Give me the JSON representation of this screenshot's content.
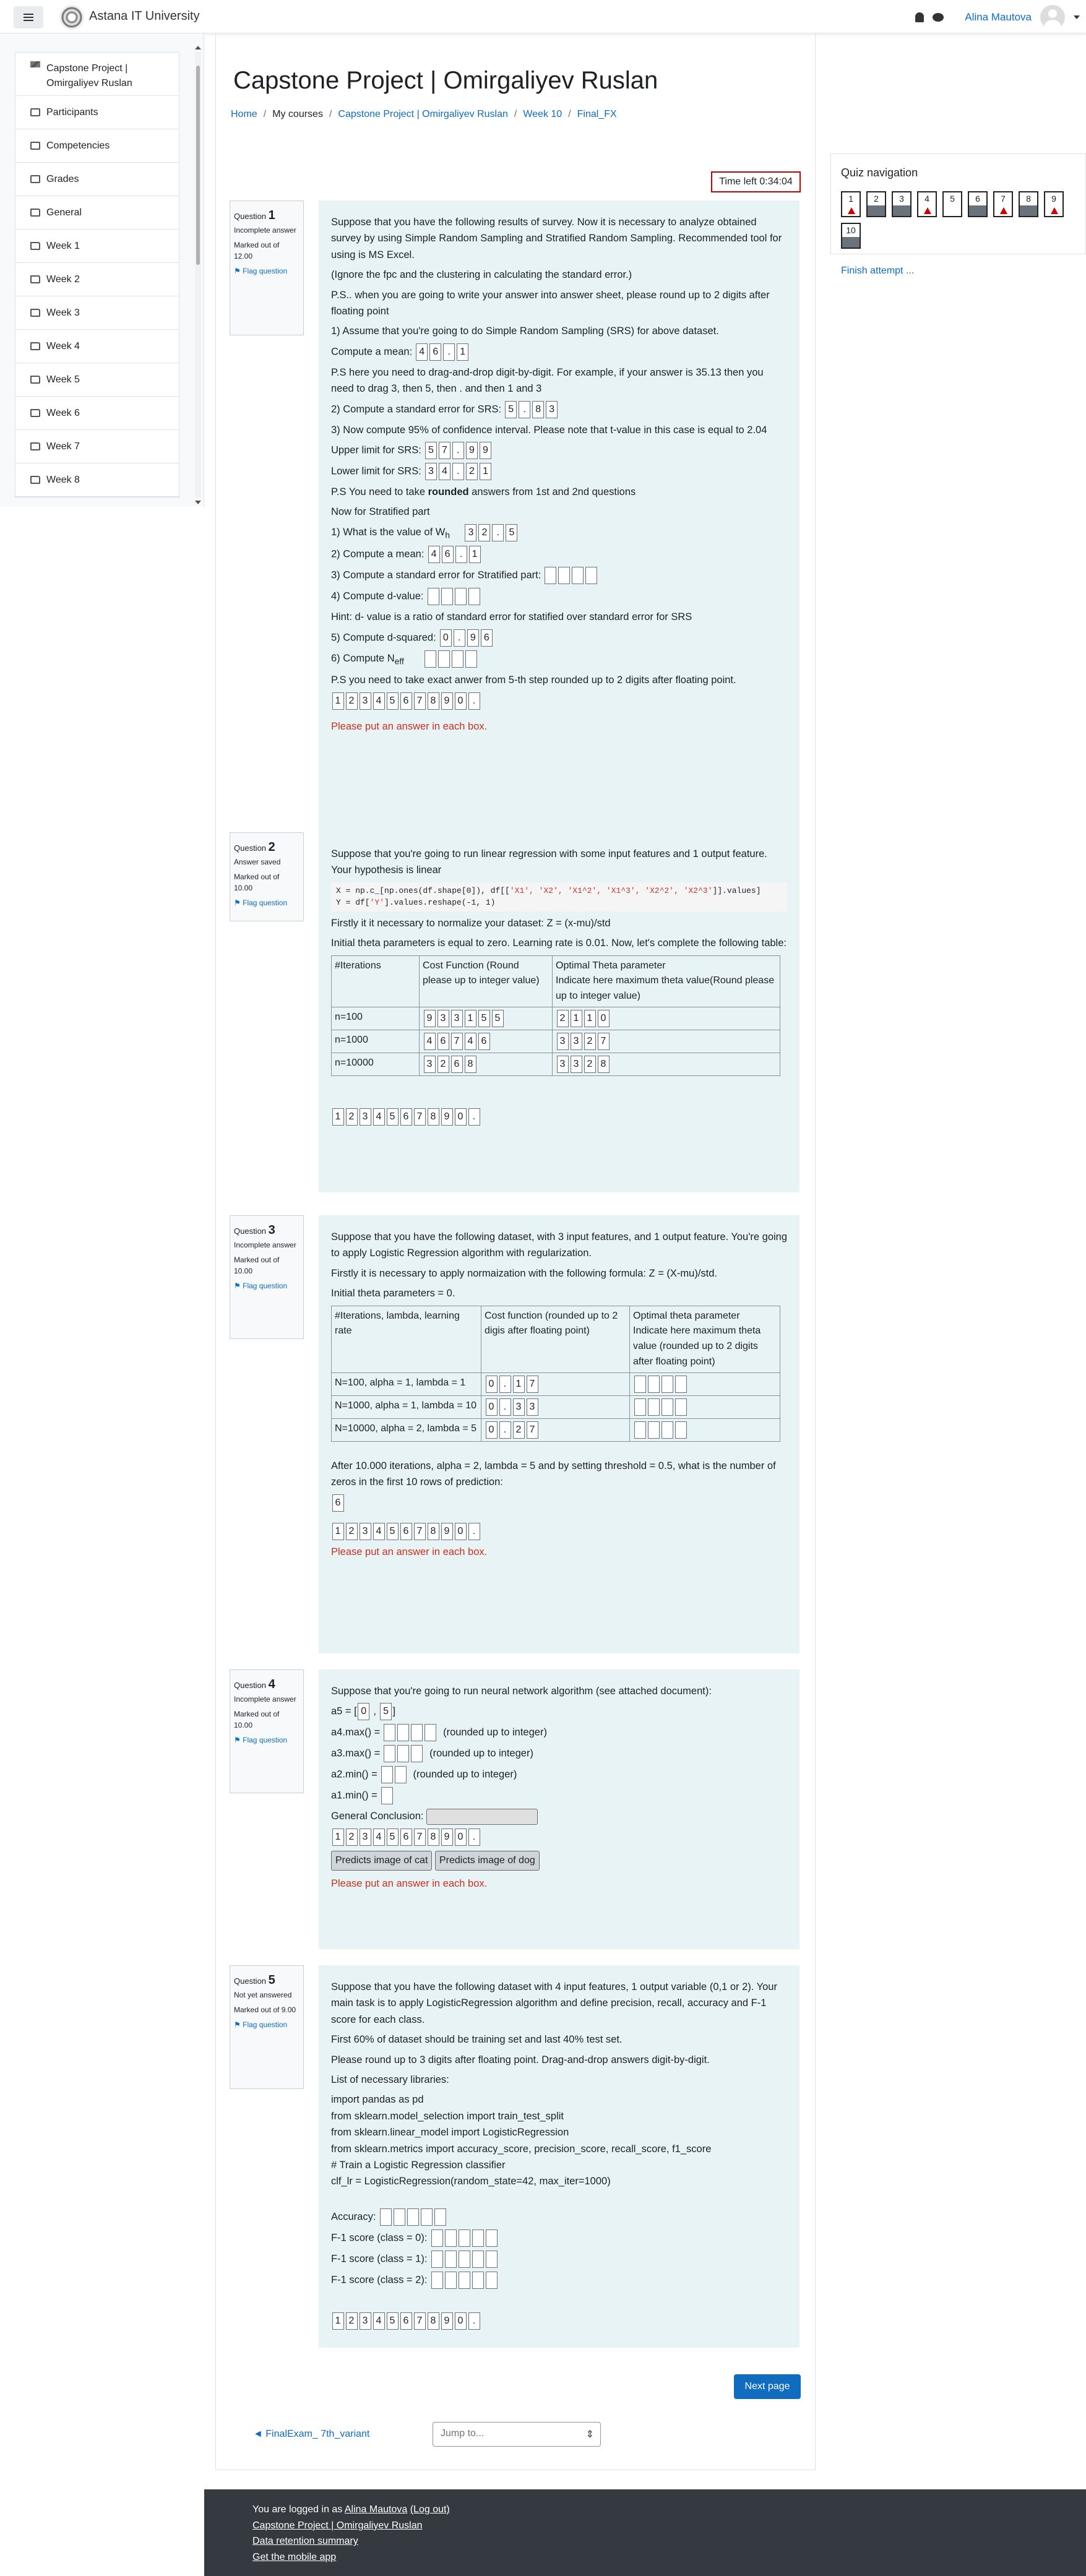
{
  "site": {
    "name": "Astana IT University"
  },
  "user": {
    "name": "Alina Mautova"
  },
  "drawer": {
    "items": [
      {
        "label": "Capstone Project | Omirgaliyev Ruslan",
        "icon": "graduation-cap-icon"
      },
      {
        "label": "Participants",
        "icon": "users-icon"
      },
      {
        "label": "Competencies",
        "icon": "checkbox-icon"
      },
      {
        "label": "Grades",
        "icon": "table-icon"
      },
      {
        "label": "General",
        "icon": "folder-icon"
      },
      {
        "label": "Week 1",
        "icon": "folder-icon"
      },
      {
        "label": "Week 2",
        "icon": "folder-icon"
      },
      {
        "label": "Week 3",
        "icon": "folder-icon"
      },
      {
        "label": "Week 4",
        "icon": "folder-icon"
      },
      {
        "label": "Week 5",
        "icon": "folder-icon"
      },
      {
        "label": "Week 6",
        "icon": "folder-icon"
      },
      {
        "label": "Week 7",
        "icon": "folder-icon"
      },
      {
        "label": "Week 8",
        "icon": "folder-icon"
      }
    ]
  },
  "page": {
    "title": "Capstone Project | Omirgaliyev Ruslan"
  },
  "breadcrumb": [
    "Home",
    "My courses",
    "Capstone Project | Omirgaliyev Ruslan",
    "Week 10",
    "Final_FX"
  ],
  "timer": "Time left 0:34:04",
  "flag_label": "Flag question",
  "q1": {
    "no": "1",
    "state": "Incomplete answer",
    "marks": "Marked out of 12.00",
    "text1": "Suppose that you have the following results of survey. Now it is necessary to analyze obtained survey by using Simple Random Sampling and Stratified Random Sampling. Recommended tool for using is MS Excel.",
    "text2": "(Ignore the fpc and the clustering in calculating the standard error.)",
    "text3": "P.S.. when you are going to write your answer into answer sheet, please round up to 2 digits after floating point",
    "text4": "1) Assume that you're going to do Simple Random Sampling (SRS) for above dataset.",
    "l_mean": "Compute a mean:",
    "text5": "P.S here you need to drag-and-drop digit-by-digit. For example, if your answer is 35.13 then you need to drag 3, then 5, then . and then 1 and 3",
    "l_se": "2) Compute a standard error for SRS:",
    "text6": "3) Now compute 95% of confidence interval. Please note that t-value in this case is equal to 2.04",
    "l_upper": "Upper limit for SRS:",
    "l_lower": "Lower limit for SRS:",
    "text7a": "P.S You need to take ",
    "text7b": "rounded",
    "text7c": " answers from 1st and 2nd questions",
    "text8": "Now for Stratified part",
    "l_wh": "1) What is the value of W",
    "l_wh_sub": "h",
    "l_mean2": "2) Compute a mean:",
    "l_se2": "3) Compute a standard error for Stratified part:",
    "l_d": "4) Compute d-value:",
    "text9": "Hint: d- value is a ratio of standard error for statified over standard error for SRS",
    "l_d2": "5) Compute d-squared:",
    "l_neff": "6) Compute N",
    "l_neff_sub": "eff",
    "text10": "P.S you need to take exact anwer from 5-th step rounded up to 2 digits after floating point.",
    "error": "Please put an answer in each box."
  },
  "q2": {
    "no": "2",
    "state": "Answer saved",
    "marks": "Marked out of 10.00",
    "text1": "Suppose that you're going to run linear regression with some input features and 1 output feature. Your hypothesis is linear",
    "code1a": "X = np.c_[np.ones(df.shape[0]), df[[",
    "code1s": "'X1', 'X2', 'X1^2', 'X1^3', 'X2^2', 'X2^3'",
    "code1b": "]].values]",
    "code2a": "Y = df[",
    "code2s": "'Y'",
    "code2b": "].values.reshape(-1, 1)",
    "text2": "Firstly it it necessary to normalize your dataset: Z = (x-mu)/std",
    "text3": "Initial theta parameters is equal to zero. Learning rate is 0.01. Now, let's complete the following table:",
    "th1": "#Iterations",
    "th2": "Cost Function (Round please up to integer value)",
    "th3": "Optimal Theta parameter",
    "th3b": "Indicate here maximum theta value(Round please up to integer value)",
    "r1": "n=100",
    "r2": "n=1000",
    "r3": "n=10000"
  },
  "q3": {
    "no": "3",
    "state": "Incomplete answer",
    "marks": "Marked out of 10.00",
    "text1": "Suppose that you have the following dataset, with 3 input features, and 1 output feature. You're going to apply Logistic Regression algorithm with regularization.",
    "text2": "Firstly it is necessary to apply normaization with the following formula: Z = (X-mu)/std.",
    "text3": "Initial theta parameters = 0.",
    "th1": "#Iterations, lambda, learning rate",
    "th2": "Cost function (rounded up to 2 digis after floating point)",
    "th3": "Optimal theta parameter",
    "th3b": "Indicate here maximum theta value (rounded up to 2 digits after floating point)",
    "r1": "N=100, alpha = 1, lambda = 1",
    "r2": "N=1000, alpha = 1, lambda = 10",
    "r3": "N=10000, alpha = 2, lambda = 5",
    "text4": "After 10.000 iterations, alpha = 2, lambda = 5  and by setting threshold = 0.5, what is the number of zeros in the first 10 rows of prediction:",
    "error": "Please put an answer in each box."
  },
  "q4": {
    "no": "4",
    "state": "Incomplete answer",
    "marks": "Marked out of 10.00",
    "text1": "Suppose that you're going to run neural network algorithm (see attached document):",
    "l_a5": "a5 = [",
    "l_a4": "a4.max() =",
    "l_a4r": "(rounded up to integer)",
    "l_a3": "a3.max() =",
    "l_a3r": "(rounded up to integer)",
    "l_a2": "a2.min() =",
    "l_a2r": "(rounded up to integer)",
    "l_a1": "a1.min() =",
    "l_gc": "General Conclusion:",
    "btn_cat": "Predicts image of cat",
    "btn_dog": "Predicts image of dog",
    "error": "Please put an answer in each box."
  },
  "q5": {
    "no": "5",
    "state": "Not yet answered",
    "marks": "Marked out of 9.00",
    "text1": "Suppose that you have the following dataset with 4 input features, 1 output variable (0,1 or 2). Your main task is to apply LogisticRegression algorithm and define precision, recall, accuracy and F-1 score for each class.",
    "text2": "First 60% of dataset should be training set and last 40% test set.",
    "text3": "Please round up to 3 digits after floating point. Drag-and-drop answers digit-by-digit.",
    "text4": "List of necessary libraries:",
    "lib1": "import pandas as pd",
    "lib2": "from sklearn.model_selection import train_test_split",
    "lib3": "from sklearn.linear_model import LogisticRegression",
    "lib4": "from sklearn.metrics import accuracy_score, precision_score, recall_score, f1_score",
    "lib5": "# Train a Logistic Regression classifier",
    "lib6": "clf_lr = LogisticRegression(random_state=42, max_iter=1000)",
    "l_acc": "Accuracy:",
    "l_f0": "F-1 score (class = 0):",
    "l_f1": "F-1 score (class = 1):",
    "l_f2": "F-1 score (class = 2):"
  },
  "digits": [
    "1",
    "2",
    "3",
    "4",
    "5",
    "6",
    "7",
    "8",
    "9",
    "0",
    "."
  ],
  "answers": {
    "q1_mean": [
      "4",
      "6",
      ".",
      "1"
    ],
    "q1_se": [
      "5",
      ".",
      "8",
      "3"
    ],
    "q1_upper": [
      "5",
      "7",
      ".",
      "9",
      "9"
    ],
    "q1_lower": [
      "3",
      "4",
      ".",
      "2",
      "1"
    ],
    "q1_wh": [
      "3",
      "2",
      ".",
      "5"
    ],
    "q1_mean2": [
      "4",
      "6",
      ".",
      "1"
    ],
    "q1_d2": [
      "0",
      ".",
      "9",
      "6"
    ],
    "q2_r1c": [
      "9",
      "3",
      "3",
      "1",
      "5",
      "5"
    ],
    "q2_r1t": [
      "2",
      "1",
      "1",
      "0"
    ],
    "q2_r2c": [
      "4",
      "6",
      "7",
      "4",
      "6"
    ],
    "q2_r2t": [
      "3",
      "3",
      "2",
      "7"
    ],
    "q2_r3c": [
      "3",
      "2",
      "6",
      "8"
    ],
    "q2_r3t": [
      "3",
      "3",
      "2",
      "8"
    ],
    "q3_r1": [
      "0",
      ".",
      "1",
      "7"
    ],
    "q3_r2": [
      "0",
      ".",
      "3",
      "3"
    ],
    "q3_r3": [
      "0",
      ".",
      "2",
      "7"
    ],
    "q3_zeros": "6",
    "q4_a5": [
      "0",
      "5"
    ]
  },
  "quiz_nav": {
    "title": "Quiz navigation",
    "finish": "Finish attempt ...",
    "items": [
      "1",
      "2",
      "3",
      "4",
      "5",
      "6",
      "7",
      "8",
      "9",
      "10"
    ]
  },
  "next_label": "Next page",
  "prev_link": "◄ FinalExam_ 7th_variant",
  "jump_placeholder": "Jump to...",
  "footer": {
    "logged_in": "You are logged in as ",
    "user": "Alina Mautova",
    "logout": "(Log out)",
    "course": "Capstone Project | Omirgaliyev Ruslan",
    "retention": "Data retention summary",
    "mobile": "Get the mobile app"
  }
}
